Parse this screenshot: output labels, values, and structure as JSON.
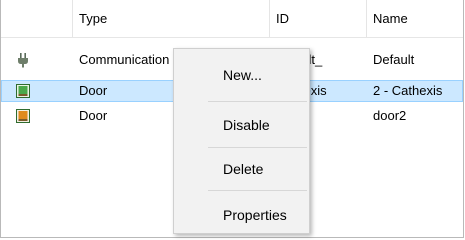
{
  "columns": {
    "type": "Type",
    "id": "ID",
    "name": "Name"
  },
  "rows": [
    {
      "icon": "plug-icon",
      "type": "Communication channel",
      "id": "default_",
      "name": "Default",
      "selected": false
    },
    {
      "icon": "door-green-icon",
      "type": "Door",
      "id": "Cathexis",
      "name": "2 - Cathexis",
      "selected": true
    },
    {
      "icon": "door-orange-icon",
      "type": "Door",
      "id": "",
      "name": "door2",
      "selected": false
    }
  ],
  "context_menu": {
    "items": [
      "New...",
      "Disable",
      "Delete",
      "Properties"
    ]
  },
  "colors": {
    "selection_bg": "#cce8ff",
    "selection_border": "#99d1ff",
    "menu_bg": "#f2f2f2",
    "door_green": "#4aa84a",
    "door_orange": "#e08a1e"
  }
}
